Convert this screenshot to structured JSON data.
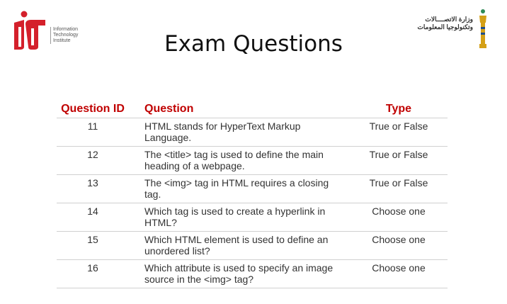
{
  "logos": {
    "iti_text": [
      "Information",
      "Technology",
      "Institute"
    ],
    "ministry_text": [
      "وزارة الاتصــــالات",
      "وتكنولوجيا المعلومات"
    ]
  },
  "title": "Exam Questions",
  "table": {
    "headers": {
      "id": "Question ID",
      "question": "Question",
      "type": "Type"
    },
    "rows": [
      {
        "id": "11",
        "question": "HTML stands for HyperText Markup Language.",
        "type": "True or False"
      },
      {
        "id": "12",
        "question": "The <title> tag is used to define the main heading of a webpage.",
        "type": "True or False"
      },
      {
        "id": "13",
        "question": "The <img> tag in HTML requires a closing tag.",
        "type": "True or False"
      },
      {
        "id": "14",
        "question": "Which tag is used to create a hyperlink in HTML?",
        "type": "Choose one"
      },
      {
        "id": "15",
        "question": "Which HTML element is used to define an unordered list?",
        "type": "Choose one"
      },
      {
        "id": "16",
        "question": "Which attribute is used to specify an image source in the <img> tag?",
        "type": "Choose one"
      }
    ]
  },
  "colors": {
    "header_red": "#c00000",
    "iti_red": "#d4202b",
    "rule": "#d0d0d0"
  }
}
